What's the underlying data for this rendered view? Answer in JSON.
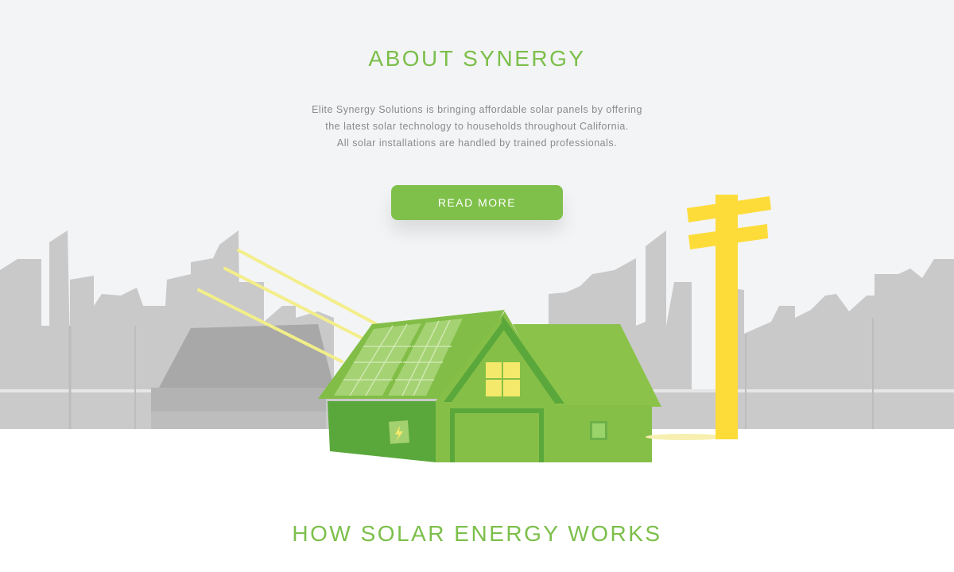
{
  "about": {
    "title": "ABOUT SYNERGY",
    "lines": [
      "Elite Synergy Solutions is bringing affordable solar panels by offering",
      "the latest solar technology to households throughout California.",
      "All solar installations are handled by trained professionals."
    ],
    "button_label": "READ MORE"
  },
  "how": {
    "title": "HOW SOLAR ENERGY WORKS"
  },
  "illustration": {
    "icons": [
      "city-skyline",
      "solar-house-icon",
      "solar-panel-icon",
      "lightning-icon",
      "utility-pole-icon",
      "sun-ray-icon"
    ]
  },
  "colors": {
    "accent": "#7cbf4a",
    "button": "#7fc04a",
    "house_dark": "#5aa83b",
    "house_light": "#8bc34a",
    "pole": "#fddc3a",
    "skyline": "#c8c8c8",
    "background": "#f3f4f6"
  }
}
